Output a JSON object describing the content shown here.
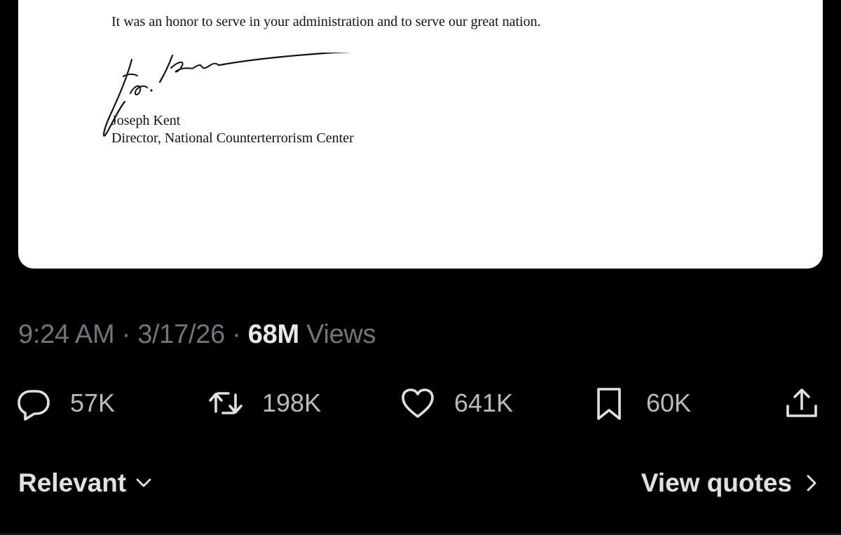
{
  "letter": {
    "closing_line": "It was an honor to serve in your administration and to serve our great nation.",
    "signature_text": "Joe Kent",
    "signer_name": "Joseph Kent",
    "signer_title": "Director, National Counterterrorism Center"
  },
  "post_meta": {
    "time": "9:24 AM",
    "separator": "·",
    "date": "3/17/26",
    "views_count": "68M",
    "views_label": "Views"
  },
  "actions": {
    "reply_count": "57K",
    "repost_count": "198K",
    "like_count": "641K",
    "bookmark_count": "60K"
  },
  "replies_sort": {
    "label": "Relevant"
  },
  "quotes_link": {
    "label": "View quotes"
  },
  "colors": {
    "background": "#000000",
    "secondary_text": "#71767b",
    "primary_text": "#e7e9ea",
    "document_paper": "#ffffff"
  },
  "icons": {
    "reply": "speech-bubble-icon",
    "repost": "repost-arrows-icon",
    "like": "heart-icon",
    "bookmark": "bookmark-icon",
    "share": "share-upload-icon",
    "sort": "chevron-down-icon",
    "quotes": "chevron-right-icon"
  }
}
